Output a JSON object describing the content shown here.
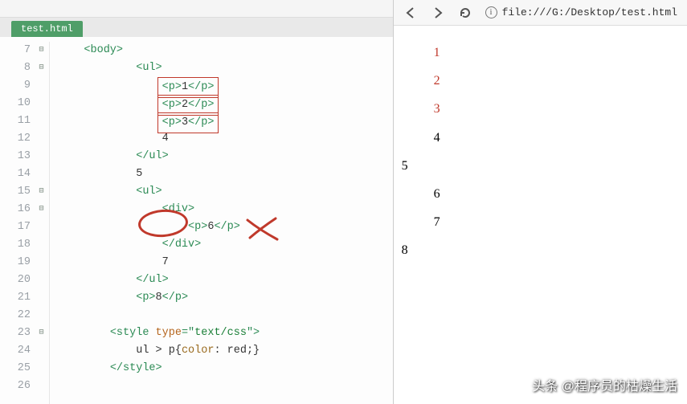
{
  "editor": {
    "tab": "test.html",
    "gutter_start": 7,
    "gutter_end": 26,
    "fold_lines": [
      7,
      8,
      15,
      16,
      23
    ],
    "code_lines": {
      "l7": {
        "indent": 2,
        "tokens": [
          {
            "t": "tag",
            "v": "<body>"
          }
        ]
      },
      "l8": {
        "indent": 6,
        "tokens": [
          {
            "t": "tag",
            "v": "<ul>"
          }
        ]
      },
      "l9": {
        "indent": 8,
        "box": true,
        "tokens": [
          {
            "t": "tag",
            "v": "<p>"
          },
          {
            "t": "num",
            "v": "1"
          },
          {
            "t": "tag",
            "v": "</p>"
          }
        ]
      },
      "l10": {
        "indent": 8,
        "box": true,
        "tokens": [
          {
            "t": "tag",
            "v": "<p>"
          },
          {
            "t": "num",
            "v": "2"
          },
          {
            "t": "tag",
            "v": "</p>"
          }
        ]
      },
      "l11": {
        "indent": 8,
        "box": true,
        "tokens": [
          {
            "t": "tag",
            "v": "<p>"
          },
          {
            "t": "num",
            "v": "3"
          },
          {
            "t": "tag",
            "v": "</p>"
          }
        ]
      },
      "l12": {
        "indent": 8,
        "tokens": [
          {
            "t": "num",
            "v": "4"
          }
        ]
      },
      "l13": {
        "indent": 6,
        "tokens": [
          {
            "t": "tag",
            "v": "</ul>"
          }
        ]
      },
      "l14": {
        "indent": 6,
        "tokens": [
          {
            "t": "num",
            "v": "5"
          }
        ]
      },
      "l15": {
        "indent": 6,
        "tokens": [
          {
            "t": "tag",
            "v": "<ul>"
          }
        ]
      },
      "l16": {
        "indent": 8,
        "tokens": [
          {
            "t": "tag",
            "v": "<div>"
          }
        ]
      },
      "l17": {
        "indent": 10,
        "tokens": [
          {
            "t": "tag",
            "v": "<p>"
          },
          {
            "t": "num",
            "v": "6"
          },
          {
            "t": "tag",
            "v": "</p>"
          }
        ]
      },
      "l18": {
        "indent": 8,
        "tokens": [
          {
            "t": "tag",
            "v": "</div>"
          }
        ]
      },
      "l19": {
        "indent": 8,
        "tokens": [
          {
            "t": "num",
            "v": "7"
          }
        ]
      },
      "l20": {
        "indent": 6,
        "tokens": [
          {
            "t": "tag",
            "v": "</ul>"
          }
        ]
      },
      "l21": {
        "indent": 6,
        "tokens": [
          {
            "t": "tag",
            "v": "<p>"
          },
          {
            "t": "num",
            "v": "8"
          },
          {
            "t": "tag",
            "v": "</p>"
          }
        ]
      },
      "l22": {
        "indent": 0,
        "tokens": []
      },
      "l23": {
        "indent": 4,
        "tokens": [
          {
            "t": "tag",
            "v": "<style "
          },
          {
            "t": "attr",
            "v": "type"
          },
          {
            "t": "tag",
            "v": "=\""
          },
          {
            "t": "val",
            "v": "text/css"
          },
          {
            "t": "tag",
            "v": "\">"
          }
        ]
      },
      "l24": {
        "indent": 6,
        "tokens": [
          {
            "t": "css",
            "v": "ul > p{"
          },
          {
            "t": "prop",
            "v": "color"
          },
          {
            "t": "css",
            "v": ": red;}"
          }
        ]
      },
      "l25": {
        "indent": 4,
        "tokens": [
          {
            "t": "tag",
            "v": "</style>"
          }
        ]
      },
      "l26": {
        "indent": 0,
        "tokens": []
      }
    }
  },
  "browser": {
    "url": "file:///G:/Desktop/test.html",
    "rendered": [
      {
        "text": "1",
        "indent": true,
        "red": true
      },
      {
        "text": "2",
        "indent": true,
        "red": true
      },
      {
        "text": "3",
        "indent": true,
        "red": true
      },
      {
        "text": "4",
        "indent": true,
        "red": false
      },
      {
        "text": "5",
        "indent": false,
        "red": false
      },
      {
        "text": "6",
        "indent": true,
        "red": false
      },
      {
        "text": "7",
        "indent": true,
        "red": false
      },
      {
        "text": "8",
        "indent": false,
        "red": false
      }
    ]
  },
  "watermark": "头条 @程序员的枯燥生活"
}
